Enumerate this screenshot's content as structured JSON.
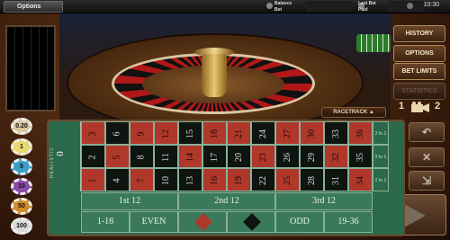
{
  "topbar": {
    "options_label": "Options",
    "balance_label": "Balance",
    "bet_label": "Bet",
    "last_bet_label": "Last Bet",
    "paid_label": "Paid",
    "clock": "10:30"
  },
  "right_menu": {
    "history": "HISTORY",
    "options": "OPTIONS",
    "bet_limits": "BET LIMITS",
    "dimmed": "STATISTICS"
  },
  "racetrack_label": "RACETRACK ▲",
  "view_numbers": [
    "1",
    "2"
  ],
  "chips": [
    {
      "value": "0.20",
      "color": "#d8c8a0"
    },
    {
      "value": "1",
      "color": "#e8d870"
    },
    {
      "value": "5",
      "color": "#3aa0c8"
    },
    {
      "value": "10",
      "color": "#8a4aa8"
    },
    {
      "value": "50",
      "color": "#d08a2a"
    },
    {
      "value": "100",
      "color": "#d8d8d8"
    }
  ],
  "table": {
    "zero": "0",
    "rows": [
      [
        {
          "n": "3",
          "c": "red"
        },
        {
          "n": "6",
          "c": "black"
        },
        {
          "n": "9",
          "c": "red"
        },
        {
          "n": "12",
          "c": "red"
        },
        {
          "n": "15",
          "c": "black"
        },
        {
          "n": "18",
          "c": "red"
        },
        {
          "n": "21",
          "c": "red"
        },
        {
          "n": "24",
          "c": "black"
        },
        {
          "n": "27",
          "c": "red"
        },
        {
          "n": "30",
          "c": "red"
        },
        {
          "n": "33",
          "c": "black"
        },
        {
          "n": "36",
          "c": "red"
        }
      ],
      [
        {
          "n": "2",
          "c": "black"
        },
        {
          "n": "5",
          "c": "red"
        },
        {
          "n": "8",
          "c": "black"
        },
        {
          "n": "11",
          "c": "black"
        },
        {
          "n": "14",
          "c": "red"
        },
        {
          "n": "17",
          "c": "black"
        },
        {
          "n": "20",
          "c": "black"
        },
        {
          "n": "23",
          "c": "red"
        },
        {
          "n": "26",
          "c": "black"
        },
        {
          "n": "29",
          "c": "black"
        },
        {
          "n": "32",
          "c": "red"
        },
        {
          "n": "35",
          "c": "black"
        }
      ],
      [
        {
          "n": "1",
          "c": "red"
        },
        {
          "n": "4",
          "c": "black"
        },
        {
          "n": "7",
          "c": "red"
        },
        {
          "n": "10",
          "c": "black"
        },
        {
          "n": "13",
          "c": "black"
        },
        {
          "n": "16",
          "c": "red"
        },
        {
          "n": "19",
          "c": "red"
        },
        {
          "n": "22",
          "c": "black"
        },
        {
          "n": "25",
          "c": "red"
        },
        {
          "n": "28",
          "c": "black"
        },
        {
          "n": "31",
          "c": "black"
        },
        {
          "n": "34",
          "c": "red"
        }
      ]
    ],
    "column_bet": "2 to 1",
    "dozens": [
      "1st 12",
      "2nd 12",
      "3rd 12"
    ],
    "outside": [
      "1-18",
      "EVEN",
      "ODD",
      "19-36"
    ],
    "side_text": "REALISTIC"
  }
}
